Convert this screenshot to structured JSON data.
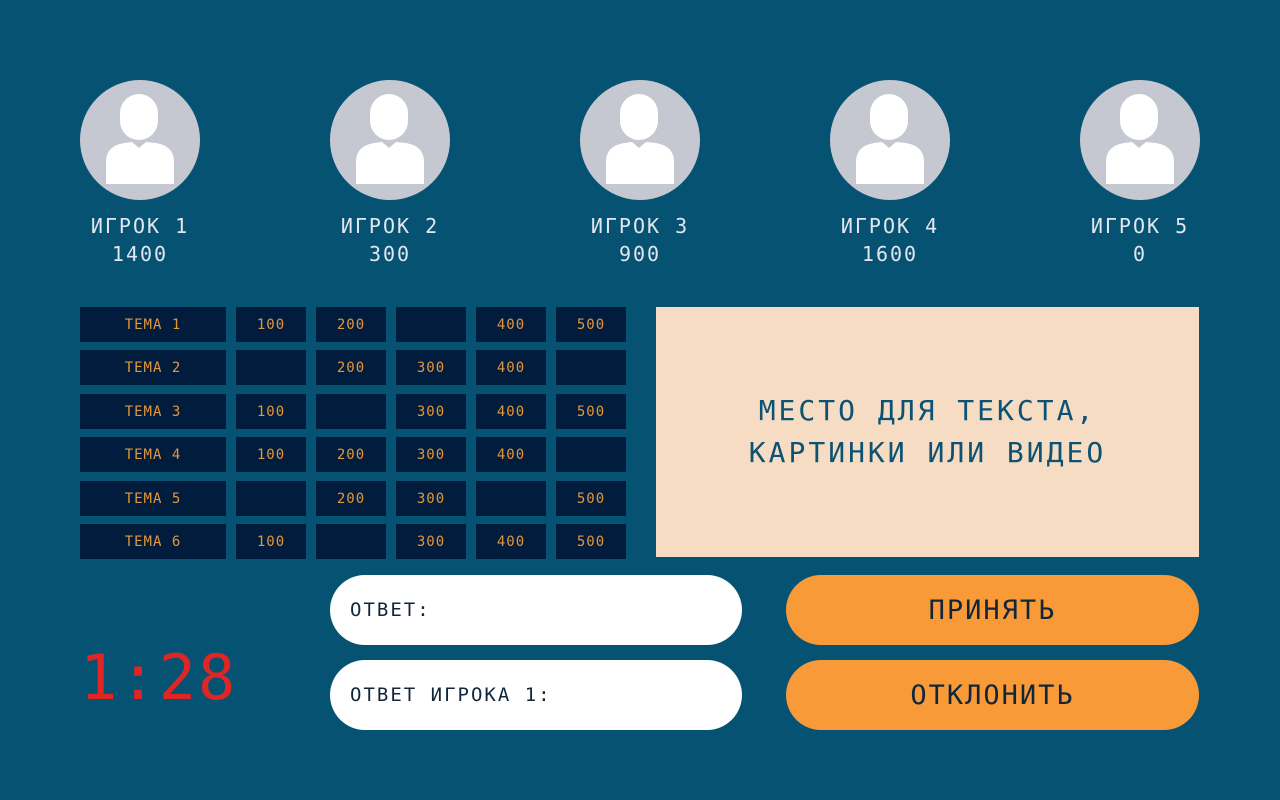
{
  "players": [
    {
      "name": "ИГРОК 1",
      "score": "1400"
    },
    {
      "name": "ИГРОК 2",
      "score": "300"
    },
    {
      "name": "ИГРОК 3",
      "score": "900"
    },
    {
      "name": "ИГРОК 4",
      "score": "1600"
    },
    {
      "name": "ИГРОК 5",
      "score": "0"
    }
  ],
  "board": {
    "rows": [
      {
        "theme": "ТЕМА 1",
        "values": [
          "100",
          "200",
          "",
          "400",
          "500"
        ]
      },
      {
        "theme": "ТЕМА 2",
        "values": [
          "",
          "200",
          "300",
          "400",
          ""
        ]
      },
      {
        "theme": "ТЕМА 3",
        "values": [
          "100",
          "",
          "300",
          "400",
          "500"
        ]
      },
      {
        "theme": "ТЕМА 4",
        "values": [
          "100",
          "200",
          "300",
          "400",
          ""
        ]
      },
      {
        "theme": "ТЕМА 5",
        "values": [
          "",
          "200",
          "300",
          "",
          "500"
        ]
      },
      {
        "theme": "ТЕМА 6",
        "values": [
          "100",
          "",
          "300",
          "400",
          "500"
        ]
      }
    ]
  },
  "media": {
    "text": "МЕСТО ДЛЯ ТЕКСТА,\nКАРТИНКИ ИЛИ ВИДЕО"
  },
  "timer": "1:28",
  "answer_field": {
    "label": "ОТВЕТ:"
  },
  "player_answer_field": {
    "label": "ОТВЕТ ИГРОКА 1:"
  },
  "buttons": {
    "accept": "ПРИНЯТЬ",
    "reject": "ОТКЛОНИТЬ"
  },
  "colors": {
    "background": "#065273",
    "cell": "#021c3e",
    "cell_text": "#e2973a",
    "media_box": "#f6dcc2",
    "button": "#f89a38",
    "timer": "#e02525",
    "avatar": "#c5c8d1"
  }
}
